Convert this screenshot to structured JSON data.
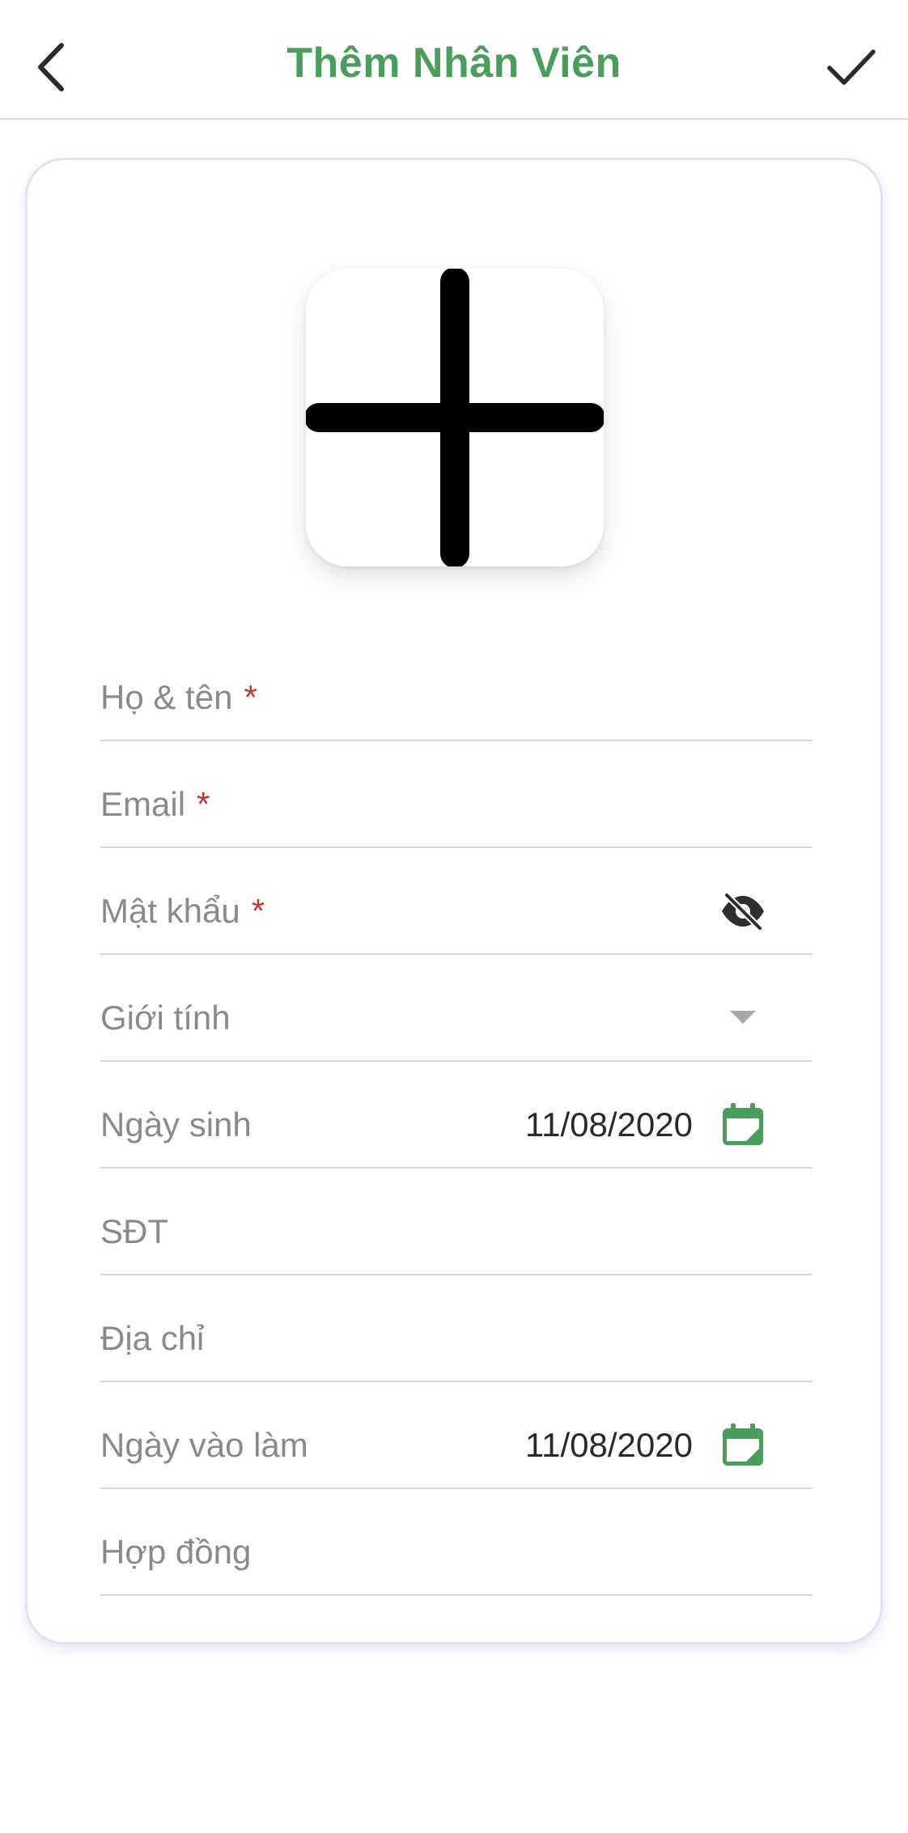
{
  "header": {
    "title": "Thêm Nhân Viên",
    "back_icon": "chevron-left-icon",
    "confirm_icon": "checkmark-icon"
  },
  "avatar": {
    "icon": "plus-icon"
  },
  "form": {
    "full_name": {
      "label": "Họ & tên",
      "required_mark": "*"
    },
    "email": {
      "label": "Email",
      "required_mark": "*"
    },
    "password": {
      "label": "Mật khẩu",
      "required_mark": "*",
      "icon": "eye-off-icon"
    },
    "gender": {
      "label": "Giới tính",
      "icon": "dropdown-triangle-icon"
    },
    "birth_date": {
      "label": "Ngày sinh",
      "value": "11/08/2020",
      "icon": "calendar-icon"
    },
    "phone": {
      "label": "SĐT"
    },
    "address": {
      "label": "Địa chỉ"
    },
    "start_date": {
      "label": "Ngày vào làm",
      "value": "11/08/2020",
      "icon": "calendar-icon"
    },
    "contract": {
      "label": "Hợp đồng"
    }
  },
  "colors": {
    "accent": "#4a9e5c",
    "required": "#c0392b",
    "label": "#8a8a8a",
    "divider": "#d6d6d6"
  }
}
